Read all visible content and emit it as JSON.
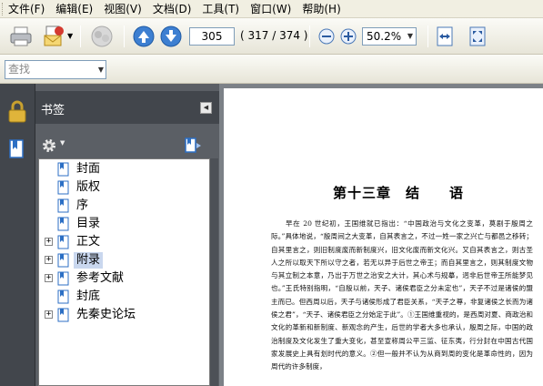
{
  "menu": {
    "items": [
      "文件(F)",
      "编辑(E)",
      "视图(V)",
      "文档(D)",
      "工具(T)",
      "窗口(W)",
      "帮助(H)"
    ]
  },
  "toolbar": {
    "current_page": "305",
    "page_count": "( 317 / 374 )",
    "zoom": "50.2%",
    "icons": [
      "print-icon",
      "email-icon",
      "collaborate-icon",
      "previous-page-icon",
      "next-page-icon",
      "zoom-out-icon",
      "zoom-in-icon",
      "fit-width-icon",
      "full-screen-icon"
    ]
  },
  "find": {
    "placeholder": "查找"
  },
  "bookmarks": {
    "title": "书签",
    "items": [
      {
        "label": "封面",
        "expandable": false,
        "selected": false
      },
      {
        "label": "版权",
        "expandable": false,
        "selected": false
      },
      {
        "label": "序",
        "expandable": false,
        "selected": false
      },
      {
        "label": "目录",
        "expandable": false,
        "selected": false
      },
      {
        "label": "正文",
        "expandable": true,
        "selected": false
      },
      {
        "label": "附录",
        "expandable": true,
        "selected": true
      },
      {
        "label": "参考文献",
        "expandable": true,
        "selected": false
      },
      {
        "label": "封底",
        "expandable": false,
        "selected": false
      },
      {
        "label": "先秦史论坛",
        "expandable": true,
        "selected": false
      }
    ]
  },
  "document": {
    "chapter_title": "第十三章　结　　语",
    "body": "早在 20 世纪初，王国维就已指出：“中国政治与文化之变革，莫剧于殷周之际。”具体地说，“殷周间之大变革，自其表言之，不过一姓一家之兴亡与都邑之移转；自其里言之，则旧制度废而新制度兴，旧文化废而新文化兴。又自其表言之，则古圣人之所以取天下所以守之者，若无以异于后世之帝王；而自其里言之，则其制度文物与其立制之本意，乃出于万世之治安之大计，其心术与规摹，迥非后世帝王所能梦见也。”王氏特别指明，“自殷以前，天子、诸侯君臣之分未定也”，天子不过是诸侯的盟主而已。但西周以后，天子与诸侯形成了君臣关系，“天子之尊，非复诸侯之长而为诸侯之君”，“天子、诸侯君臣之分始定于此”。①王国维重视的，是西周对夏、商政治和文化的革新和新制度、新观念的产生，后世的学者大多也承认，殷周之际，中国的政治制度及文化发生了重大变化，甚至宣称周公平三监、征东夷，行分封在中国古代国家发展史上具有划时代的意义。②但一般并不认为从商到周的变化是革命性的，因为周代的许多制度，"
  }
}
